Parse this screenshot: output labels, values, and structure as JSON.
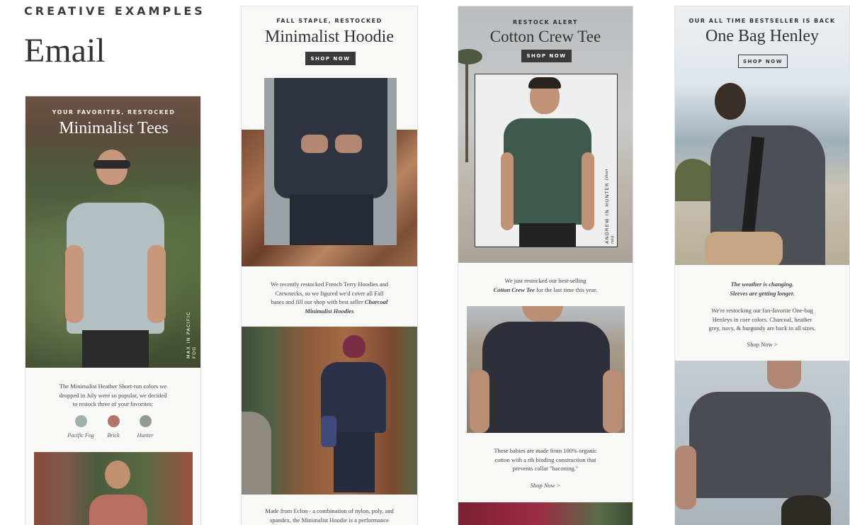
{
  "header": {
    "label": "CREATIVE EXAMPLES",
    "title": "Email"
  },
  "cards": [
    {
      "eyebrow": "YOUR FAVORITES, RESTOCKED",
      "title": "Minimalist Tees",
      "vertical_label": "MAX IN PACIFIC FOG",
      "body": "The Minimalist Heather Short-run colors we dropped in July were so popular, we decided to restock three of your favorites:",
      "swatches": [
        {
          "label": "Pacific Fog",
          "color": "#9fb0aa"
        },
        {
          "label": "Brick",
          "color": "#b0766c"
        },
        {
          "label": "Hunter",
          "color": "#8e9d8c"
        }
      ]
    },
    {
      "eyebrow": "FALL STAPLE, RESTOCKED",
      "title": "Minimalist Hoodie",
      "button": "SHOP NOW",
      "body_pre": "We recently restocked French Terry Hoodies and Crewnecks, so we figured we'd cover all Fall bases and fill our shop with best seller",
      "body_em": "Charcoal Minimalist Hoodies",
      "footer": "Made from Eclon - a combination of nylon, poly, and spandex, the Minimalist Hoodie is a performance meets"
    },
    {
      "eyebrow": "RESTOCK ALERT",
      "title": "Cotton Crew Tee",
      "button": "SHOP NOW",
      "vertical_label": "ANDREW IN HUNTER",
      "vertical_note": "(short run)",
      "body_pre": "We just restocked our best-selling",
      "body_em": "Cotton Crew Tee",
      "body_post": "for the last time this year.",
      "body2": "These babies are made from 100% organic cotton with a rib binding construction that prevents collar \"baconing.\"",
      "link": "Shop Now >"
    },
    {
      "eyebrow": "OUR ALL TIME BESTSELLER IS BACK",
      "title": "One Bag Henley",
      "button": "SHOP NOW",
      "tagline_1": "The weather is changing.",
      "tagline_2": "Sleeves are getting longer.",
      "body": "We're restocking our fan-favorite One-bag Henleys in core colors. Charcoal, heather grey, navy, & burgundy are back in all sizes.",
      "link": "Shop Now >"
    }
  ],
  "colors": {
    "text_dark": "#333333",
    "button_dark": "#3a3a3a",
    "card_bg": "#f8f8f7"
  }
}
